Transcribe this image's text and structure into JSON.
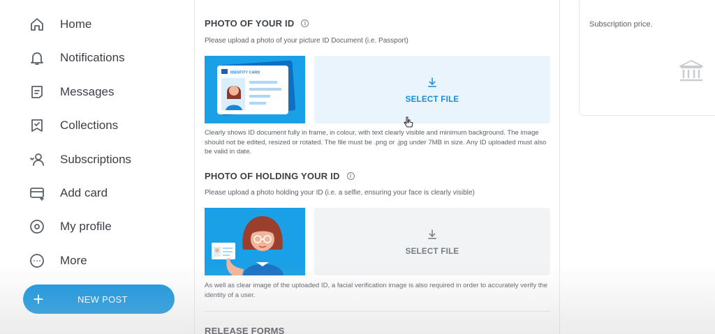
{
  "sidebar": {
    "items": [
      {
        "label": "Home",
        "icon": "home-icon"
      },
      {
        "label": "Notifications",
        "icon": "bell-icon"
      },
      {
        "label": "Messages",
        "icon": "message-icon"
      },
      {
        "label": "Collections",
        "icon": "bookmark-icon"
      },
      {
        "label": "Subscriptions",
        "icon": "subscriptions-icon"
      },
      {
        "label": "Add card",
        "icon": "card-icon"
      },
      {
        "label": "My profile",
        "icon": "profile-icon"
      },
      {
        "label": "More",
        "icon": "more-icon"
      }
    ],
    "new_post": {
      "label": "NEW POST",
      "color": "#1796e0"
    }
  },
  "main": {
    "photo_id": {
      "title": "PHOTO OF YOUR ID",
      "subtitle": "Please upload a photo of your picture ID Document (i.e. Passport)",
      "card_label": "IDENTITY CARD",
      "select_label": "SELECT FILE",
      "description": "Clearly shows ID document fully in frame, in colour, with text clearly visible and minimum background. The image should not be edited, resized or rotated. The file must be .png or .jpg under 7MB in size. Any ID uploaded must also be valid in date."
    },
    "holding_id": {
      "title": "PHOTO OF HOLDING YOUR ID",
      "subtitle": "Please upload a photo holding your ID (i.e. a selfie, ensuring your face is clearly visible)",
      "select_label": "SELECT FILE",
      "description": "As well as clear image of the uploaded ID, a facial verification image is also required in order to accurately verify the identity of a user."
    },
    "release_forms": {
      "title": "RELEASE FORMS"
    }
  },
  "right_panel": {
    "price_text": "Subscription price."
  },
  "colors": {
    "accent": "#1796e0",
    "illustration_bg": "#1aa0e6"
  }
}
